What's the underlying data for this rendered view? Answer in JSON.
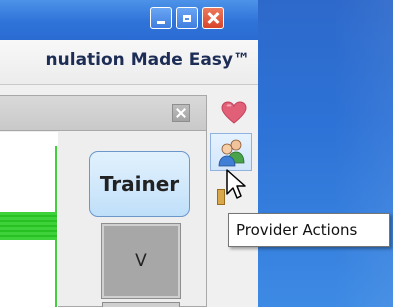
{
  "brand": {
    "text": "nulation Made Easy™"
  },
  "panel": {
    "trainer_label": "Trainer",
    "v_label": "V"
  },
  "tooltip": {
    "text": "Provider Actions"
  },
  "icons": {
    "minimize": "minimize-icon",
    "maximize": "maximize-icon",
    "close": "close-icon",
    "heart": "heart-icon",
    "provider": "provider-actions-icon",
    "cursor": "mouse-cursor-icon"
  },
  "colors": {
    "desktop": "#2d72d6",
    "titlebar": "#2f73d9",
    "close_button": "#d8452a",
    "chart_line": "#3fd13a",
    "trainer_button": "#cfe7fb",
    "brand_text": "#1d2d55"
  }
}
